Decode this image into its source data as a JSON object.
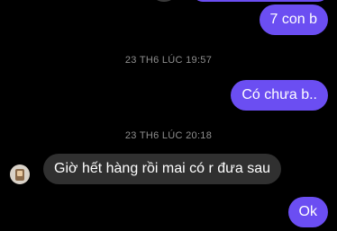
{
  "messages": [
    {
      "sender": "me",
      "text": "7 con b"
    },
    {
      "type": "timestamp",
      "text": "23 TH6 LÚC 19:57"
    },
    {
      "sender": "me",
      "text": "Có chưa b.."
    },
    {
      "type": "timestamp",
      "text": "23 TH6 LÚC 20:18"
    },
    {
      "sender": "them",
      "text": "Giờ hết hàng rồi mai có r đưa sau"
    },
    {
      "sender": "me",
      "text": "Ok"
    }
  ],
  "colors": {
    "background": "#000000",
    "outgoing_bubble": "#6b4ef2",
    "incoming_bubble": "#303030",
    "timestamp": "#8e8e8e"
  },
  "icons": {
    "contact_avatar": "contact-avatar"
  }
}
